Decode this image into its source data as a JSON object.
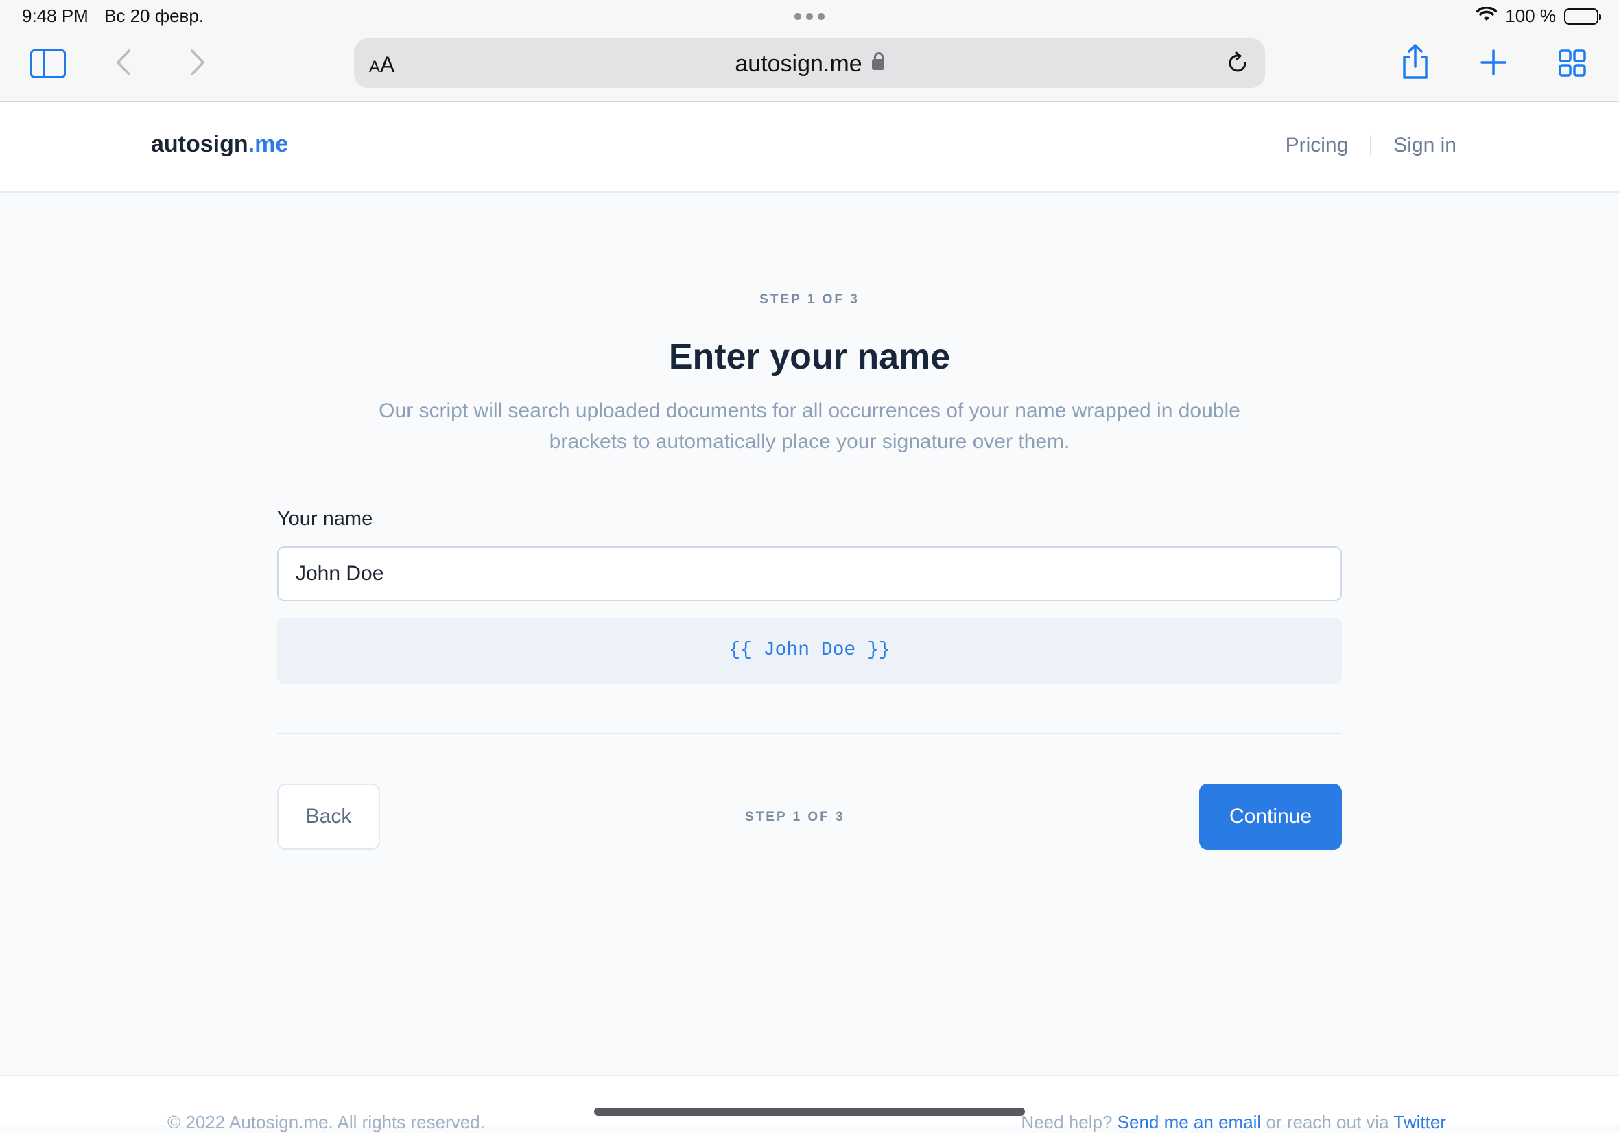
{
  "status_bar": {
    "time": "9:48 PM",
    "date": "Вс 20 февр.",
    "battery": "100 %",
    "battery_level": 1.0,
    "icons": [
      "wifi-icon",
      "battery-icon"
    ]
  },
  "browser": {
    "reader_button": "AA",
    "url": "autosign.me",
    "icons": [
      "sidebar-icon",
      "back-icon",
      "forward-icon",
      "lock-icon",
      "reload-icon",
      "share-icon",
      "plus-icon",
      "tabs-grid-icon"
    ],
    "accent_color": "#1d7bf0"
  },
  "site": {
    "logo_main": "autosign",
    "logo_accent": ".me",
    "nav": {
      "pricing": "Pricing",
      "sign_in": "Sign in"
    },
    "brand_color": "#2b7be4"
  },
  "main": {
    "step_label": "STEP 1 OF 3",
    "title": "Enter your name",
    "description": "Our script will search uploaded documents for all occurrences of your name wrapped in double brackets to automatically place your signature over them.",
    "field_label": "Your name",
    "name_value": "John Doe",
    "preview": "{{ John Doe }}"
  },
  "actions": {
    "back": "Back",
    "step_label": "STEP 1 OF 3",
    "continue": "Continue"
  },
  "footer": {
    "copyright": "© 2022 Autosign.me. All rights reserved.",
    "help_prefix": "Need help?",
    "email_link": "Send me an email",
    "help_middle": "or reach out via",
    "twitter_link": "Twitter"
  }
}
